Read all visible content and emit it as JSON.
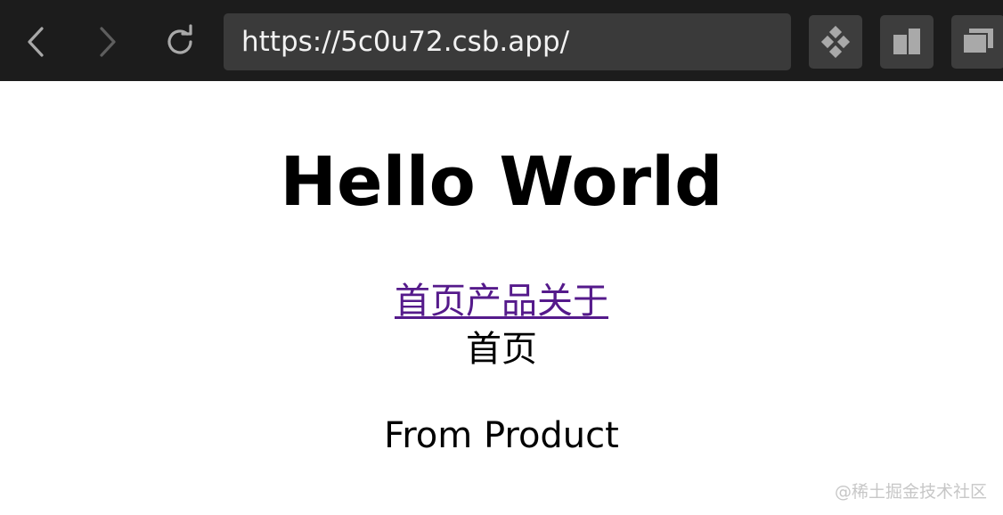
{
  "browser": {
    "url": "https://5c0u72.csb.app/",
    "icons": {
      "back": "chevron-left-icon",
      "forward": "chevron-right-icon",
      "reload": "reload-icon",
      "tool1": "diamond-grid-icon",
      "tool2": "split-panel-icon",
      "tool3": "windows-icon"
    },
    "colors": {
      "toolbar_bg": "#1c1c1c",
      "urlbar_bg": "#3a3a3a",
      "button_bg": "#3d3d3d"
    }
  },
  "page": {
    "heading": "Hello World",
    "nav_links": [
      "首页",
      "产品",
      "关于"
    ],
    "current_view": "首页",
    "from_text": "From Product",
    "watermark": "@稀土掘金技术社区",
    "colors": {
      "link": "#551a8b",
      "text": "#000000"
    }
  }
}
